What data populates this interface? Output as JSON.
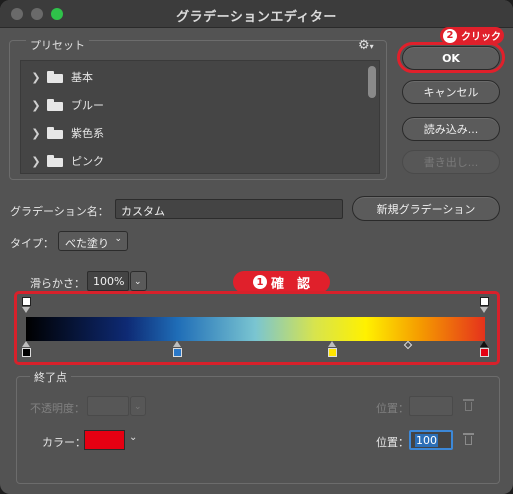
{
  "window": {
    "title": "グラデーションエディター"
  },
  "presets": {
    "label": "プリセット",
    "items": [
      {
        "label": "基本"
      },
      {
        "label": "ブルー"
      },
      {
        "label": "紫色系"
      },
      {
        "label": "ピンク"
      }
    ]
  },
  "buttons": {
    "ok": "OK",
    "cancel": "キャンセル",
    "load": "読み込み...",
    "export": "書き出し...",
    "new_gradient": "新規グラデーション"
  },
  "annotations": {
    "click": {
      "number": "2",
      "text": "クリック"
    },
    "confirm": {
      "number": "1",
      "text": "確　認"
    }
  },
  "name": {
    "label": "グラデーション名：",
    "value": "カスタム"
  },
  "type": {
    "label": "タイプ：",
    "value": "べた塗り"
  },
  "smoothness": {
    "label": "滑らかさ：",
    "value": "100%"
  },
  "end_point": {
    "label": "終了点",
    "opacity_label": "不透明度：",
    "opacity_location_label": "位置：",
    "color_label": "カラー：",
    "color_location_label": "位置：",
    "color_location_value": "100"
  },
  "colors": {
    "annotation_red": "#e0202b",
    "selected_color": "#e60012",
    "stop_blue": "#2a78c8",
    "stop_yellow": "#ffe400"
  }
}
